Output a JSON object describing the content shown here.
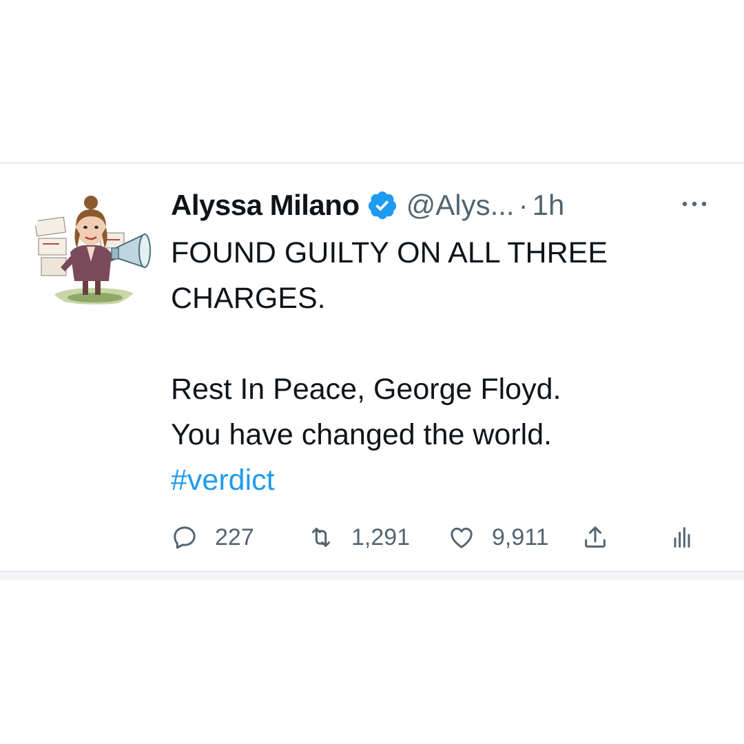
{
  "tweet": {
    "display_name": "Alyssa Milano",
    "handle": "@Alys...",
    "separator": "·",
    "time": "1h",
    "lines": [
      "FOUND GUILTY ON ALL THREE",
      "CHARGES.",
      "Rest In Peace, George Floyd.",
      "You have changed the world."
    ],
    "hashtag": "#verdict"
  },
  "actions": {
    "replies": "227",
    "retweets": "1,291",
    "likes": "9,911"
  },
  "icons": {
    "reply": "reply-icon",
    "retweet": "retweet-icon",
    "like": "heart-icon",
    "share": "share-icon",
    "analytics": "analytics-icon",
    "more": "more-icon",
    "verified": "verified-badge-icon"
  },
  "colors": {
    "text": "#0f1419",
    "secondary": "#536471",
    "accent": "#1d9bf0",
    "divider": "#cfd9de"
  }
}
